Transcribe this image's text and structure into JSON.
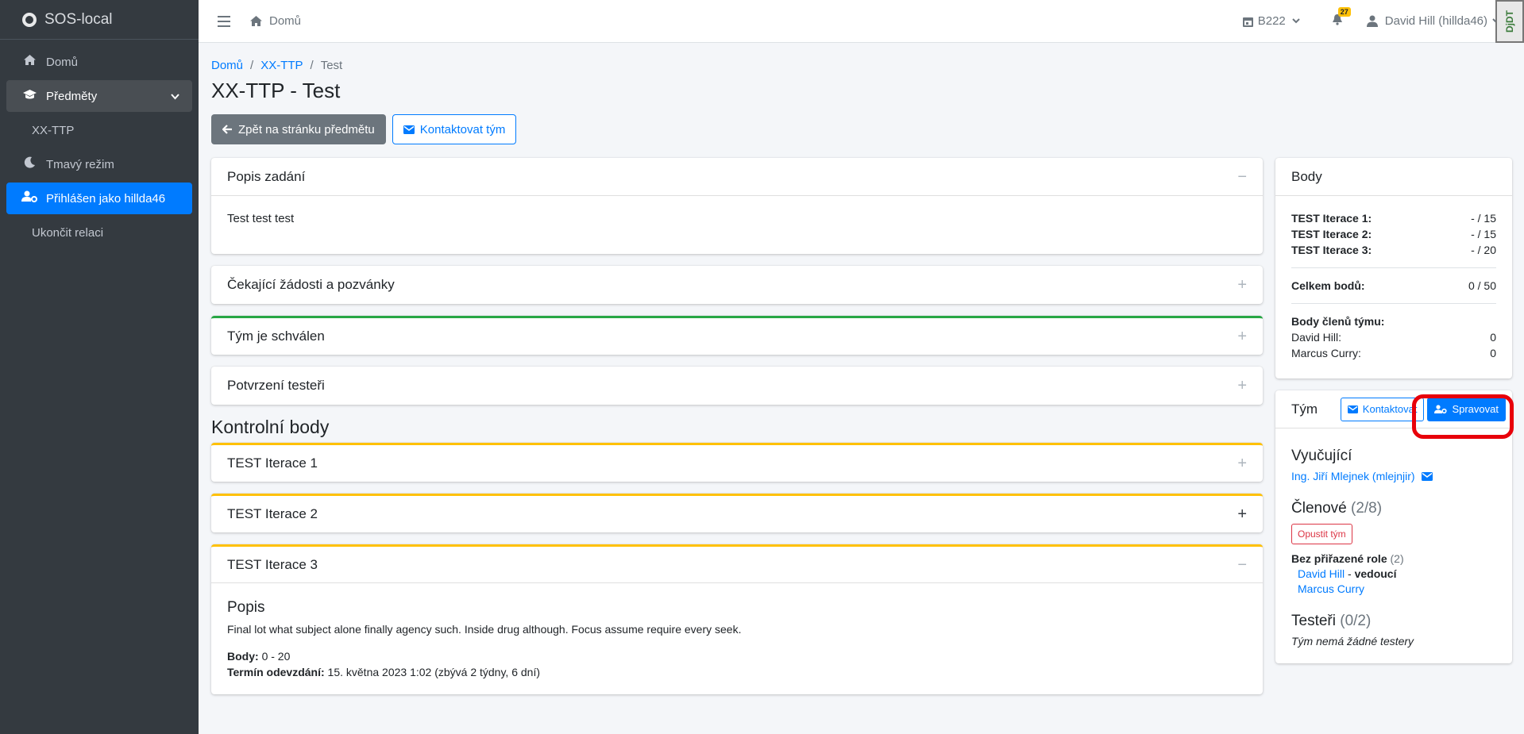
{
  "sidebar": {
    "brand": "SOS-local",
    "items": [
      {
        "label": "Domů"
      },
      {
        "label": "Předměty"
      },
      {
        "label": "XX-TTP"
      },
      {
        "label": "Tmavý režim"
      },
      {
        "label": "Přihlášen jako hillda46"
      },
      {
        "label": "Ukončit relaci"
      }
    ]
  },
  "topbar": {
    "home": "Domů",
    "semester": "B222",
    "notifications": "27",
    "user": "David Hill (hillda46)",
    "debug": "DjDT"
  },
  "breadcrumb": [
    "Domů",
    "XX-TTP",
    "Test"
  ],
  "page_title": "XX-TTP - Test",
  "buttons": {
    "back": "Zpět na stránku předmětu",
    "contact_team": "Kontaktovat tým"
  },
  "cards": {
    "description": {
      "title": "Popis zadání",
      "body": "Test test test"
    },
    "pending": {
      "title": "Čekající žádosti a pozvánky"
    },
    "approved": {
      "title": "Tým je schválen"
    },
    "testers": {
      "title": "Potvrzení testeři"
    }
  },
  "checkpoints": {
    "title": "Kontrolní body",
    "items": [
      {
        "title": "TEST Iterace 1"
      },
      {
        "title": "TEST Iterace 2"
      },
      {
        "title": "TEST Iterace 3"
      }
    ],
    "open": {
      "heading": "Popis",
      "text": "Final lot what subject alone finally agency such. Inside drug although. Focus assume require every seek.",
      "points_label": "Body:",
      "points_value": "0 - 20",
      "deadline_label": "Termín odevzdání:",
      "deadline_value": "15. května 2023 1:02 (zbývá 2 týdny, 6 dní)"
    }
  },
  "points": {
    "title": "Body",
    "rows": [
      {
        "label": "TEST Iterace 1:",
        "value": "- / 15"
      },
      {
        "label": "TEST Iterace 2:",
        "value": "- / 15"
      },
      {
        "label": "TEST Iterace 3:",
        "value": "- / 20"
      }
    ],
    "total_label": "Celkem bodů:",
    "total_value": "0 / 50",
    "members_label": "Body členů týmu:",
    "members": [
      {
        "name": "David Hill:",
        "value": "0"
      },
      {
        "name": "Marcus Curry:",
        "value": "0"
      }
    ]
  },
  "team": {
    "title": "Tým",
    "contact": "Kontaktovat",
    "manage": "Spravovat",
    "teacher_heading": "Vyučující",
    "teacher": "Ing. Jiří Mlejnek (mlejnjir)",
    "members_heading": "Členové",
    "members_count": "(2/8)",
    "leave": "Opustit tým",
    "role_label": "Bez přiřazené role",
    "role_count": "(2)",
    "member1": "David Hill",
    "member1_sep": " - ",
    "member1_role": "vedoucí",
    "member2": "Marcus Curry",
    "testers_heading": "Testeři",
    "testers_count": "(0/2)",
    "no_testers": "Tým nemá žádné testery"
  },
  "colors": {
    "primary": "#007bff",
    "sidebar": "#343a40",
    "success": "#28a745",
    "warning": "#ffc107",
    "danger": "#dc3545",
    "highlight": "#e8000a"
  }
}
